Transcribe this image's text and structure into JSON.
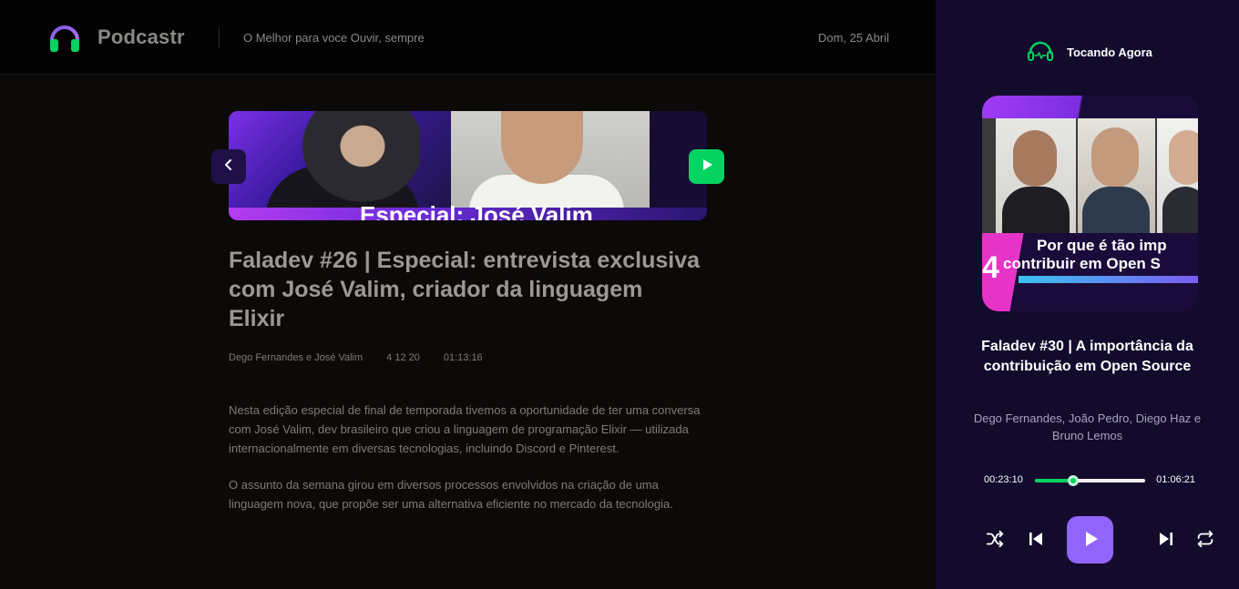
{
  "header": {
    "brand": "Podcastr",
    "tagline": "O Melhor para voce Ouvir, sempre",
    "date": "Dom, 25 Abril"
  },
  "episode": {
    "thumbnail_text": "Especial: José Valim",
    "title": "Faladev #26 | Especial: entrevista exclusiva com José Valim, criador da linguagem Elixir",
    "members": "Dego Fernandes e José Valim",
    "published_at": "4 12 20",
    "duration": "01:13:16",
    "description": [
      "Nesta edição especial de final de temporada tivemos a oportunidade de ter uma conversa com José Valim, dev brasileiro que criou a linguagem de programação Elixir — utilizada internacionalmente em diversas tecnologias, incluindo Discord e Pinterest.",
      "O assunto da semana girou em diversos processos envolvidos na criação de uma linguagem nova, que propõe ser uma alternativa eficiente no mercado da tecnologia."
    ]
  },
  "player": {
    "header_label": "Tocando Agora",
    "cover_text_line1": "Por que é tão imp",
    "cover_text_line2": "contribuir em Open S",
    "cover_number": "4",
    "title": "Faladev #30 | A importância da contribuição em Open Source",
    "members": "Dego Fernandes, João Pedro, Diego Haz e Bruno Lemos",
    "current_time": "00:23:10",
    "total_time": "01:06:21",
    "progress_fraction": 0.35
  },
  "icons": {
    "logo": "headphones-icon",
    "now_playing": "headphones-icon",
    "back": "chevron-left-icon",
    "play_episode": "play-icon",
    "shuffle": "shuffle-icon",
    "previous": "skip-previous-icon",
    "play": "play-icon",
    "next": "skip-next-icon",
    "repeat": "repeat-icon"
  },
  "colors": {
    "accent_green": "#04d361",
    "accent_purple": "#9164fa",
    "player_bg": "#130b2c",
    "main_bg": "#0c0a09"
  }
}
